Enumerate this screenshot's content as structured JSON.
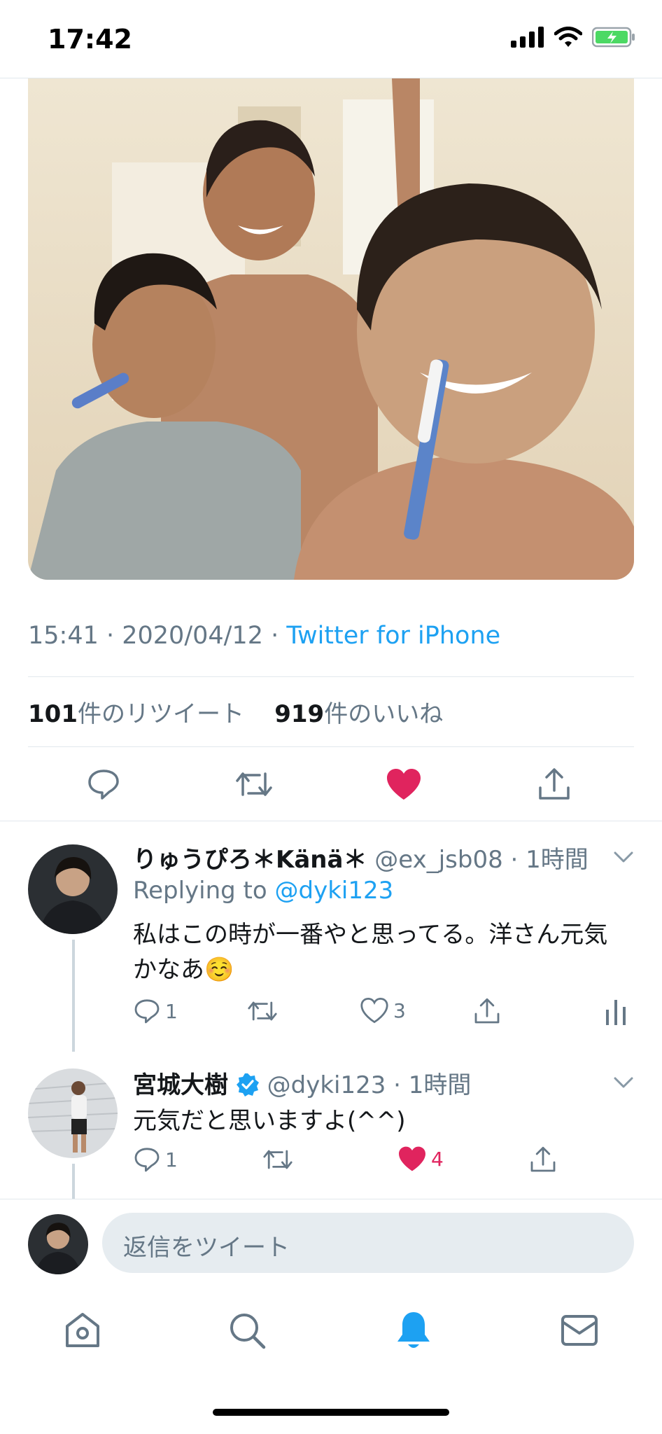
{
  "status_bar": {
    "time": "17:42"
  },
  "tweet": {
    "timestamp": "15:41 · 2020/04/12 · ",
    "client": "Twitter for iPhone",
    "retweet_count": "101",
    "retweet_label": "件のリツイート",
    "like_count": "919",
    "like_label": "件のいいね"
  },
  "replies": [
    {
      "name": "りゅうぴろ＊Känä＊",
      "handle": "@ex_jsb08",
      "time": " · 1時間",
      "replying_to_label": "Replying to ",
      "replying_to": "@dyki123",
      "text_line1": "私はこの時が一番やと思ってる。洋さん元気",
      "text_line2": "かなあ",
      "emoji": "☺️",
      "reply_count": "1",
      "like_count": "3"
    },
    {
      "name": "宮城大樹",
      "handle": "@dyki123",
      "time": " · 1時間",
      "text": "元気だと思いますよ(^^)",
      "reply_count": "1",
      "like_count": "4"
    }
  ],
  "compose": {
    "placeholder": "返信をツイート"
  },
  "colors": {
    "accent": "#1da1f2",
    "like": "#e0245e",
    "text": "#14171a",
    "muted": "#657786"
  }
}
